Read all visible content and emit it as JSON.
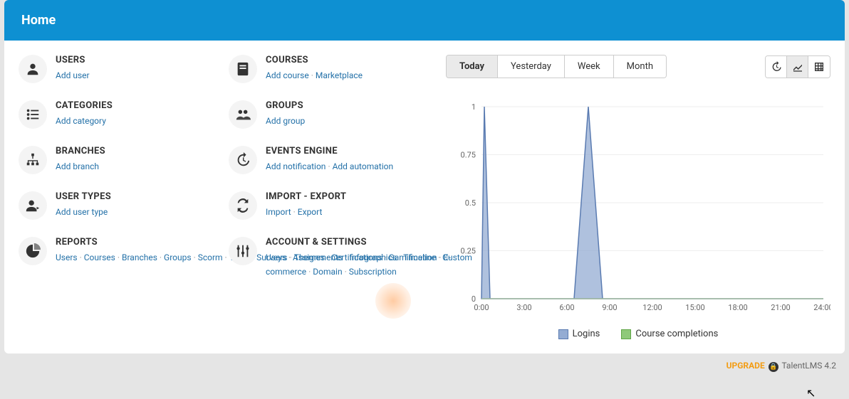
{
  "header": {
    "title": "Home"
  },
  "tiles": [
    {
      "title": "USERS",
      "links": [
        {
          "label": "Add user"
        }
      ]
    },
    {
      "title": "COURSES",
      "links": [
        {
          "label": "Add course"
        },
        {
          "label": "Marketplace"
        }
      ]
    },
    {
      "title": "CATEGORIES",
      "links": [
        {
          "label": "Add category"
        }
      ]
    },
    {
      "title": "GROUPS",
      "links": [
        {
          "label": "Add group"
        }
      ]
    },
    {
      "title": "BRANCHES",
      "links": [
        {
          "label": "Add branch"
        }
      ]
    },
    {
      "title": "EVENTS ENGINE",
      "links": [
        {
          "label": "Add notification"
        },
        {
          "label": "Add automation"
        }
      ]
    },
    {
      "title": "USER TYPES",
      "links": [
        {
          "label": "Add user type"
        }
      ]
    },
    {
      "title": "IMPORT - EXPORT",
      "links": [
        {
          "label": "Import"
        },
        {
          "label": "Export"
        }
      ]
    },
    {
      "title": "REPORTS",
      "links": [
        {
          "label": "Users"
        },
        {
          "label": "Courses"
        },
        {
          "label": "Branches"
        },
        {
          "label": "Groups"
        },
        {
          "label": "Scorm"
        },
        {
          "label": "Tests"
        },
        {
          "label": "Surveys"
        },
        {
          "label": "Assignments"
        },
        {
          "label": "Infographics"
        },
        {
          "label": "Timeline"
        },
        {
          "label": "Custom"
        }
      ]
    },
    {
      "title": "ACCOUNT & SETTINGS",
      "links": [
        {
          "label": "Users"
        },
        {
          "label": "Themes"
        },
        {
          "label": "Certifications"
        },
        {
          "label": "Gamification"
        },
        {
          "label": "E-commerce"
        },
        {
          "label": "Domain"
        },
        {
          "label": "Subscription"
        }
      ]
    }
  ],
  "tabs": [
    {
      "label": "Today",
      "active": true
    },
    {
      "label": "Yesterday",
      "active": false
    },
    {
      "label": "Week",
      "active": false
    },
    {
      "label": "Month",
      "active": false
    }
  ],
  "legend": {
    "logins": "Logins",
    "completions": "Course completions"
  },
  "footer": {
    "upgrade": "UPGRADE",
    "product": "TalentLMS 4.2"
  },
  "colors": {
    "logins_fill": "#94acd3",
    "logins_stroke": "#5a7bb1",
    "completions_fill": "#8fc97a",
    "completions_stroke": "#5fa546",
    "accent": "#0e90d2",
    "link": "#2471a8"
  },
  "chart_data": {
    "type": "area",
    "xlabel": "",
    "ylabel": "",
    "x_categories": [
      "0:00",
      "3:00",
      "6:00",
      "9:00",
      "12:00",
      "15:00",
      "18:00",
      "21:00",
      "24:00"
    ],
    "y_ticks": [
      0,
      0.25,
      0.5,
      0.75,
      1
    ],
    "ylim": [
      0,
      1
    ],
    "series": [
      {
        "name": "Logins",
        "x": [
          0,
          0.2,
          0.6,
          1,
          6.5,
          7,
          7.5,
          8,
          8.5,
          24
        ],
        "y": [
          0,
          1,
          0,
          0,
          0,
          0.5,
          1,
          0.5,
          0,
          0
        ]
      },
      {
        "name": "Course completions",
        "x": [
          0,
          24
        ],
        "y": [
          0,
          0
        ]
      }
    ]
  }
}
